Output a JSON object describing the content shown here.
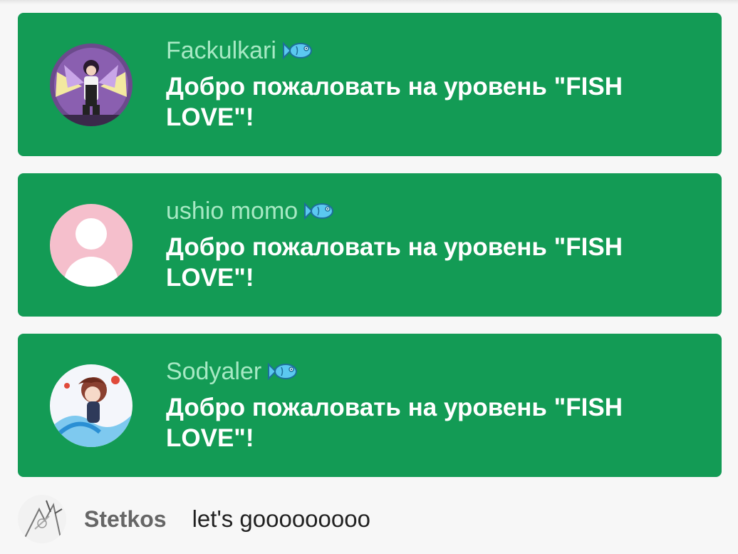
{
  "notifications": [
    {
      "username": "Fackulkari",
      "badge_icon": "fish-icon",
      "message": "Добро пожаловать на уровень \"FISH LOVE\"!",
      "avatar": "anime-avatar-purple"
    },
    {
      "username": "ushio momo",
      "badge_icon": "fish-icon",
      "message": "Добро пожаловать на уровень \"FISH LOVE\"!",
      "avatar": "default-avatar-pink"
    },
    {
      "username": "Sodyaler",
      "badge_icon": "fish-icon",
      "message": "Добро пожаловать на уровень \"FISH LOVE\"!",
      "avatar": "anime-avatar-blue"
    }
  ],
  "chat": {
    "author": "Stetkos",
    "text": "let's gooooooooo",
    "avatar": "sketch-avatar"
  },
  "colors": {
    "card_bg": "#139b55",
    "username": "#a7e9c4",
    "message": "#ffffff",
    "page_bg": "#f7f7f7",
    "fish_badge": "#5bc8f0"
  }
}
